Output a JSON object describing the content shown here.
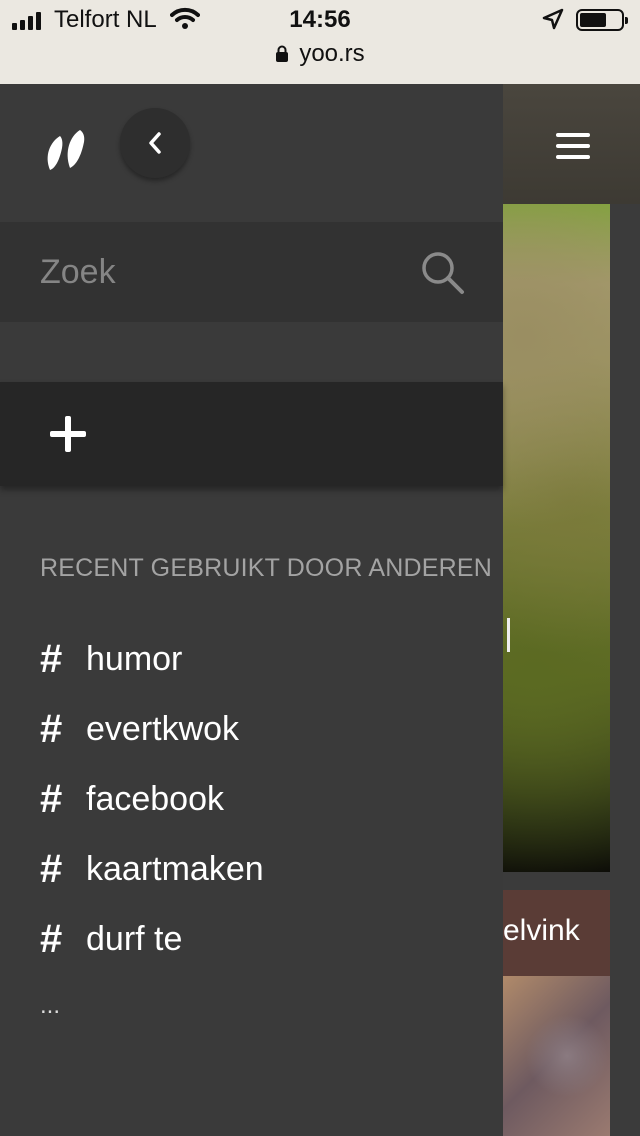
{
  "status_bar": {
    "carrier": "Telfort NL",
    "time": "14:56",
    "url": "yoo.rs",
    "battery_level": 0.65
  },
  "panel": {
    "search": {
      "placeholder": "Zoek"
    },
    "section_title": "RECENT GEBRUIKT DOOR ANDEREN",
    "tags": [
      {
        "label": "humor"
      },
      {
        "label": "evertkwok"
      },
      {
        "label": "facebook"
      },
      {
        "label": "kaartmaken"
      },
      {
        "label": "durf te"
      }
    ],
    "more_label": "..."
  },
  "background": {
    "caption_fragment": "elvink"
  },
  "colors": {
    "panel_bg": "#3a3a3a",
    "search_bg": "#323232",
    "add_bg": "#262626",
    "status_bg": "#ebe8e1"
  },
  "icons": [
    "signal-icon",
    "wifi-icon",
    "location-icon",
    "battery-icon",
    "lock-icon",
    "logo-icon",
    "chevron-left-icon",
    "search-icon",
    "plus-icon",
    "hash-icon",
    "hamburger-icon"
  ]
}
